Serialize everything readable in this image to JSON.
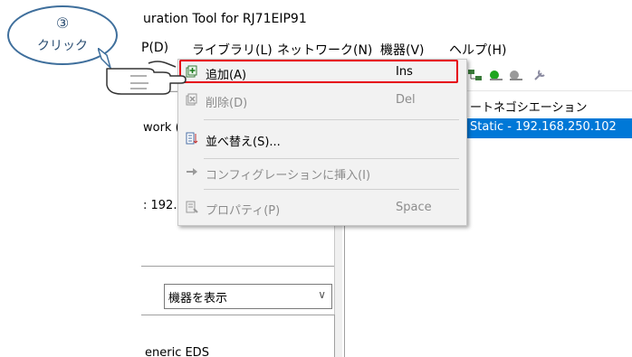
{
  "window": {
    "title": "uration Tool for RJ71EIP91"
  },
  "menubar": {
    "items": [
      {
        "label": "P(D)"
      },
      {
        "label": "ライブラリ(L)"
      },
      {
        "label": "ネットワーク(N)"
      },
      {
        "label": "機器(V)"
      },
      {
        "label": "ヘルプ(H)"
      }
    ]
  },
  "left_pane": {
    "line1": "work (",
    "line2": ": 192."
  },
  "right_pane": {
    "header_text": "ートネゴシエーション",
    "selected_row": "Static - 192.168.250.102"
  },
  "device_filter": {
    "selected": "機器を表示"
  },
  "device_list": {
    "first_item": "eneric EDS"
  },
  "context_menu": {
    "items": [
      {
        "label": "追加(A)",
        "shortcut": "Ins",
        "enabled": true
      },
      {
        "label": "削除(D)",
        "shortcut": "Del",
        "enabled": false
      },
      {
        "label": "並べ替え(S)...",
        "shortcut": "",
        "enabled": true
      },
      {
        "label": "コンフィグレーションに挿入(I)",
        "shortcut": "",
        "enabled": false
      },
      {
        "label": "プロパティ(P)",
        "shortcut": "Space",
        "enabled": false
      }
    ]
  },
  "callout": {
    "step": "③",
    "text": "クリック"
  },
  "colors": {
    "highlight": "#e60012",
    "selection": "#0078d7",
    "callout": "#3f6f9c"
  }
}
